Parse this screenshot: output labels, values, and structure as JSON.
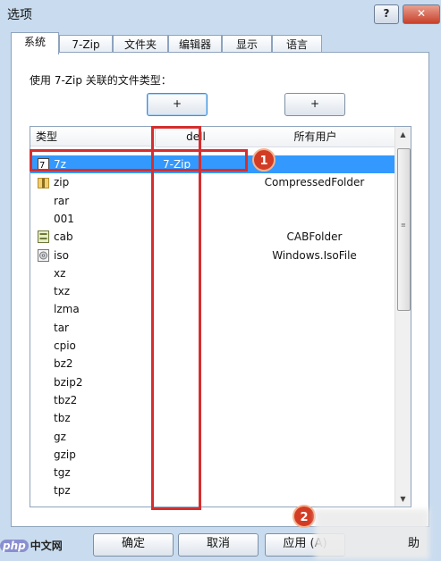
{
  "window": {
    "title": "选项",
    "help": "?",
    "close": "✕"
  },
  "tabs": [
    {
      "label": "系统",
      "active": true
    },
    {
      "label": "7-Zip",
      "active": false
    },
    {
      "label": "文件夹",
      "active": false
    },
    {
      "label": "编辑器",
      "active": false
    },
    {
      "label": "显示",
      "active": false
    },
    {
      "label": "语言",
      "active": false
    }
  ],
  "assoc_label": "使用 7-Zip 关联的文件类型：",
  "plus_buttons": [
    "+",
    "+"
  ],
  "columns": {
    "type": "类型",
    "dell": "dell",
    "all_users": "所有用户"
  },
  "rows": [
    {
      "type": "7z",
      "dell": "7-Zip",
      "all": "",
      "icon": "7zip-icon",
      "selected": true
    },
    {
      "type": "zip",
      "dell": "",
      "all": "CompressedFolder",
      "icon": "folder-zip-icon"
    },
    {
      "type": "rar",
      "dell": "",
      "all": ""
    },
    {
      "type": "001",
      "dell": "",
      "all": ""
    },
    {
      "type": "cab",
      "dell": "",
      "all": "CABFolder",
      "icon": "cab-icon"
    },
    {
      "type": "iso",
      "dell": "",
      "all": "Windows.IsoFile",
      "icon": "disc-icon"
    },
    {
      "type": "xz",
      "dell": "",
      "all": ""
    },
    {
      "type": "txz",
      "dell": "",
      "all": ""
    },
    {
      "type": "lzma",
      "dell": "",
      "all": ""
    },
    {
      "type": "tar",
      "dell": "",
      "all": ""
    },
    {
      "type": "cpio",
      "dell": "",
      "all": ""
    },
    {
      "type": "bz2",
      "dell": "",
      "all": ""
    },
    {
      "type": "bzip2",
      "dell": "",
      "all": ""
    },
    {
      "type": "tbz2",
      "dell": "",
      "all": ""
    },
    {
      "type": "tbz",
      "dell": "",
      "all": ""
    },
    {
      "type": "gz",
      "dell": "",
      "all": ""
    },
    {
      "type": "gzip",
      "dell": "",
      "all": ""
    },
    {
      "type": "tgz",
      "dell": "",
      "all": ""
    },
    {
      "type": "tpz",
      "dell": "",
      "all": ""
    }
  ],
  "annotations": {
    "badge1": "1",
    "badge2": "2"
  },
  "buttons": {
    "ok": "确定",
    "cancel": "取消",
    "apply": "应用 (A)",
    "help": "助"
  },
  "watermark": {
    "php": "php",
    "cn": "中文网"
  },
  "colors": {
    "selection": "#3399ff",
    "annotation_red": "#d62e2e"
  }
}
